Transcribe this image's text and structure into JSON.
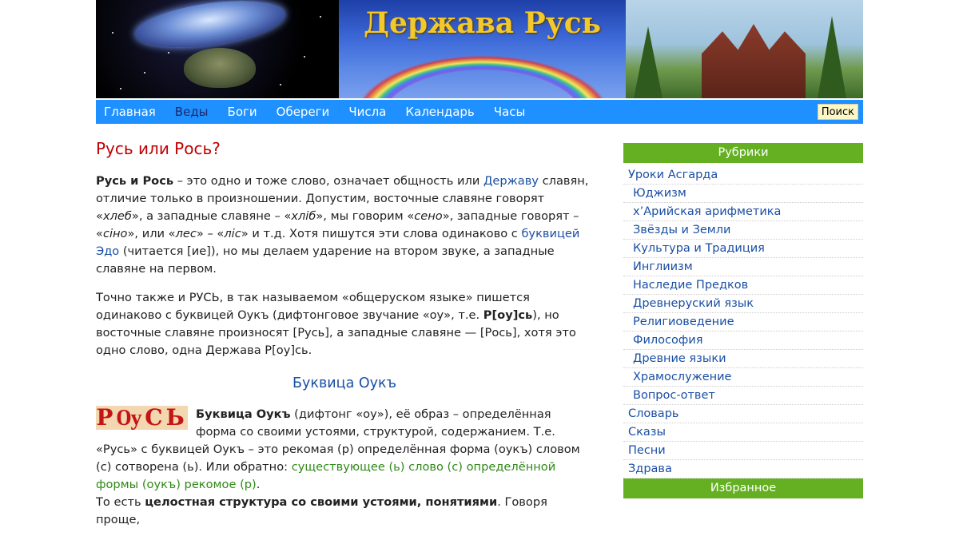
{
  "site": {
    "title": "Держава Русь"
  },
  "nav": {
    "items": [
      "Главная",
      "Веды",
      "Боги",
      "Обереги",
      "Числа",
      "Календарь",
      "Часы"
    ],
    "active_index": 1,
    "search_label": "Поиск"
  },
  "article": {
    "title": "Русь или Рось?",
    "p1": {
      "b1": "Русь и Рось",
      "t1": " – это одно и тоже слово, означает общность или ",
      "link1": "Державу",
      "t2": " славян, отличие только в произношении. Допустим, восточные славяне говорят «",
      "i1": "хлеб",
      "t3": "», а западные славяне – «",
      "i2": "хліб",
      "t4": "», мы говорим «",
      "i3": "сено",
      "t5": "», западные говорят – «",
      "i4": "сіно",
      "t6": "», или «",
      "i5": "лес",
      "t7": "» – «",
      "i6": "ліс",
      "t8": "» и т.д. Хотя пишутся эти слова одинаково с ",
      "link2": "буквицей Эдо",
      "t9": " (читается [ие]), но мы делаем ударение на втором звуке, а западные славяне на первом."
    },
    "p2": {
      "t1": "Точно также и РУСЬ, в так называемом «общеруском языке» пишется одинаково с буквицей Оукъ (дифтонговое звучание «оу», т.е. ",
      "b1": "Р[оу]сь",
      "t2": "), но восточные славяне произносят [Русь], а западные славяне — [Рось], хотя это одно слово, одна Держава Р[оу]сь."
    },
    "subtitle": "Буквица Оукъ",
    "image_text": "РѸСЬ",
    "p3": {
      "b1": "Буквица Оукъ",
      "t1": " (дифтонг «оу»), её образ – определённая форма со своими устоями, структурой, содержанием. Т.е. «Русь» с буквицей Оукъ – это рекомая (р) определённая форма (оукъ) словом (с) сотворена (ь). Или обратно: ",
      "green": "существующее (ь) слово (с) определённой формы (оукъ) рекомое (р)",
      "t2": "."
    },
    "p4": {
      "t1": "То есть ",
      "b1": "целостная структура со своими устоями, понятиями",
      "t2": ". Говоря проще,"
    }
  },
  "sidebar": {
    "rubrics_title": "Рубрики",
    "items": [
      {
        "label": "Уроки Асгарда",
        "level": 1
      },
      {
        "label": "Юджизм",
        "level": 2
      },
      {
        "label": "х’Арийская арифметика",
        "level": 2
      },
      {
        "label": "Звёзды и Земли",
        "level": 2
      },
      {
        "label": "Культура и Традиция",
        "level": 2
      },
      {
        "label": "Инглиизм",
        "level": 2
      },
      {
        "label": "Наследие Предков",
        "level": 2
      },
      {
        "label": "Древнеруский язык",
        "level": 2
      },
      {
        "label": "Религиоведение",
        "level": 2
      },
      {
        "label": "Философия",
        "level": 2
      },
      {
        "label": "Древние языки",
        "level": 2
      },
      {
        "label": "Храмослужение",
        "level": 2
      },
      {
        "label": "Вопрос-ответ",
        "level": 2
      },
      {
        "label": "Словарь",
        "level": 1
      },
      {
        "label": "Сказы",
        "level": 1
      },
      {
        "label": "Песни",
        "level": 1
      },
      {
        "label": "Здрава",
        "level": 1
      }
    ],
    "favorites_title": "Избранное"
  },
  "colors": {
    "nav_bg": "#1e90ff",
    "sidebar_head_bg": "#64b022",
    "title_red": "#c00000",
    "link_blue": "#1a4fa3",
    "site_title_gold": "#f3c829"
  }
}
